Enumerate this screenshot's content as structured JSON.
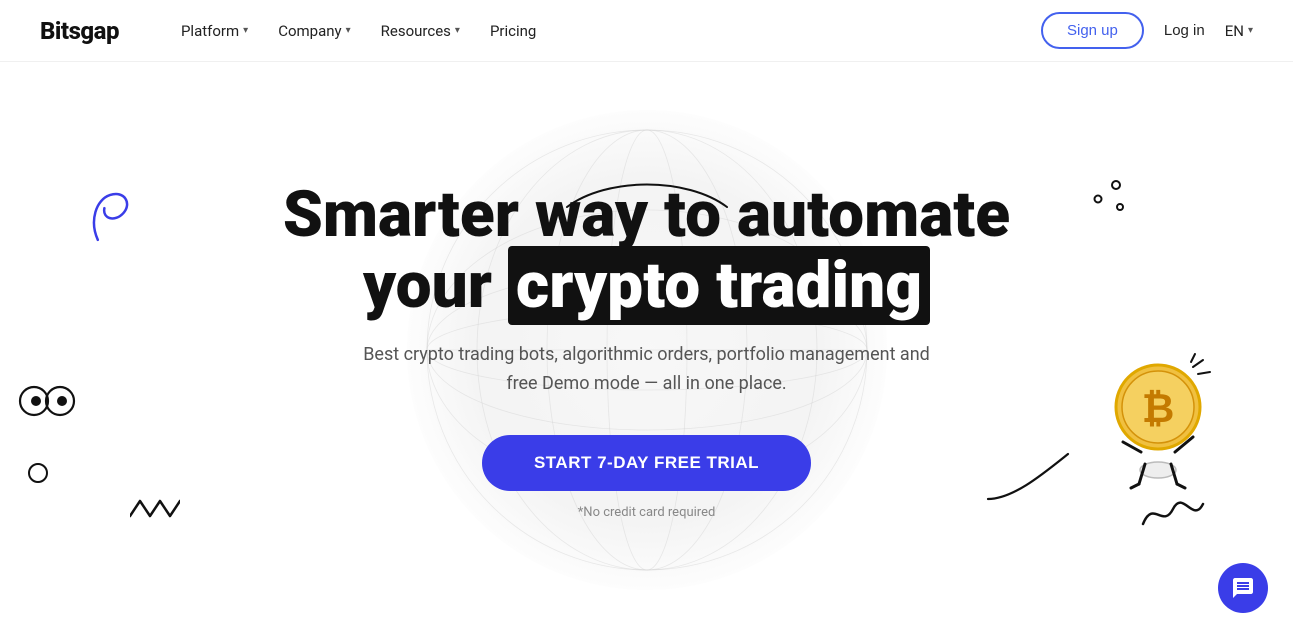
{
  "logo": "Bitsgap",
  "nav": {
    "platform_label": "Platform",
    "company_label": "Company",
    "resources_label": "Resources",
    "pricing_label": "Pricing",
    "signup_label": "Sign up",
    "login_label": "Log in",
    "lang_label": "EN"
  },
  "hero": {
    "title_line1": "Smarter way to automate",
    "title_line2_plain": "your ",
    "title_line2_highlight": "crypto trading",
    "subtitle": "Best crypto trading bots, algorithmic orders, portfolio management and free Demo mode — all in one place.",
    "cta_button": "START 7-DAY FREE TRIAL",
    "no_card_note": "*No credit card required"
  }
}
